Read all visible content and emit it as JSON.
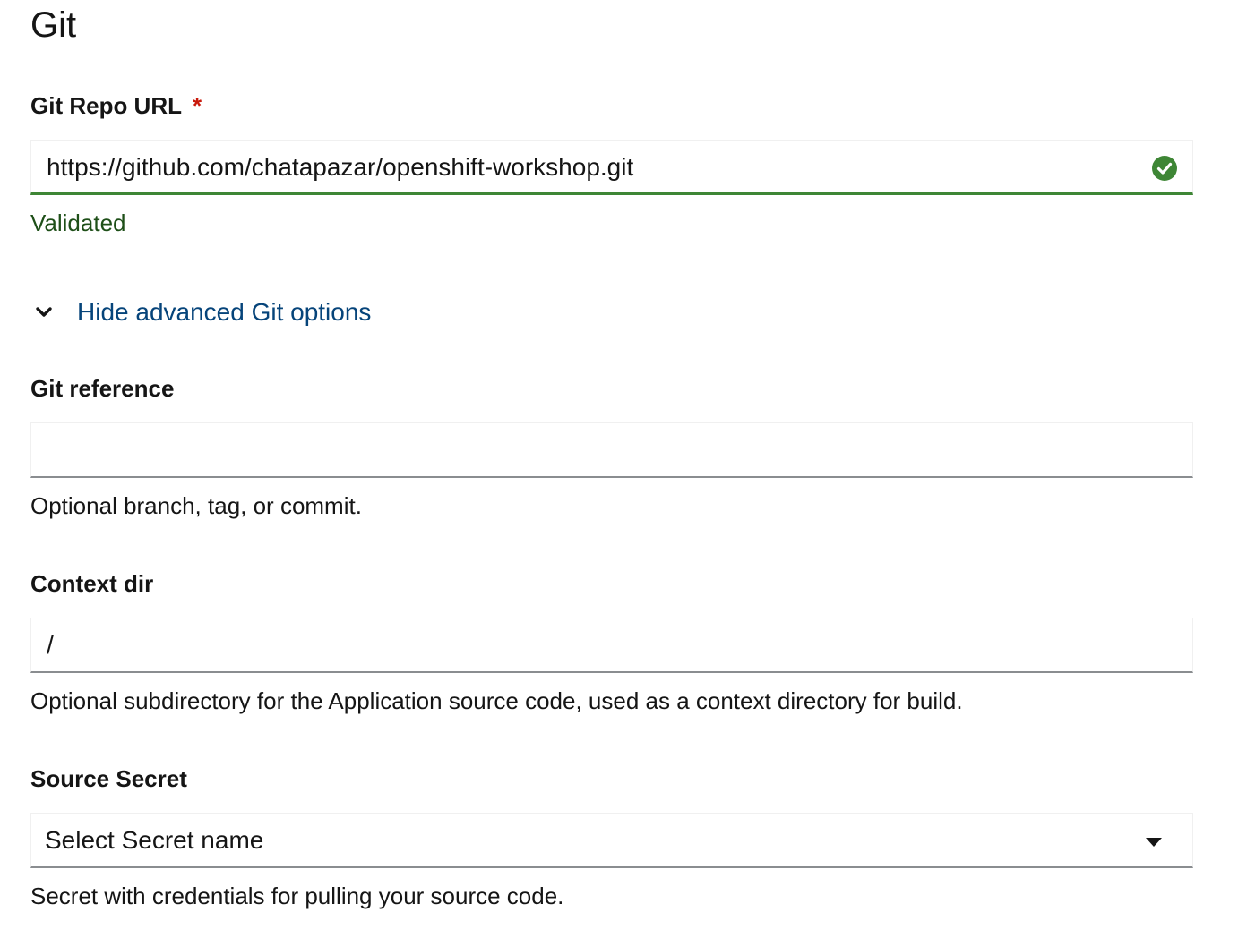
{
  "section": {
    "title": "Git"
  },
  "repo_url": {
    "label": "Git Repo URL",
    "required_mark": "*",
    "value": "https://github.com/chatapazar/openshift-workshop.git",
    "status_icon": "check-circle-icon",
    "helper": "Validated"
  },
  "advanced_toggle": {
    "icon": "chevron-down-icon",
    "label": "Hide advanced Git options"
  },
  "git_reference": {
    "label": "Git reference",
    "value": "",
    "helper": "Optional branch, tag, or commit."
  },
  "context_dir": {
    "label": "Context dir",
    "value": "/",
    "helper": "Optional subdirectory for the Application source code, used as a context directory for build."
  },
  "source_secret": {
    "label": "Source Secret",
    "selected": "Select Secret name",
    "icon": "caret-down-icon",
    "helper": "Secret with credentials for pulling your source code."
  },
  "colors": {
    "success": "#3e8635",
    "success_text": "#1e4f18",
    "link": "#06447a",
    "required": "#c9190b"
  }
}
